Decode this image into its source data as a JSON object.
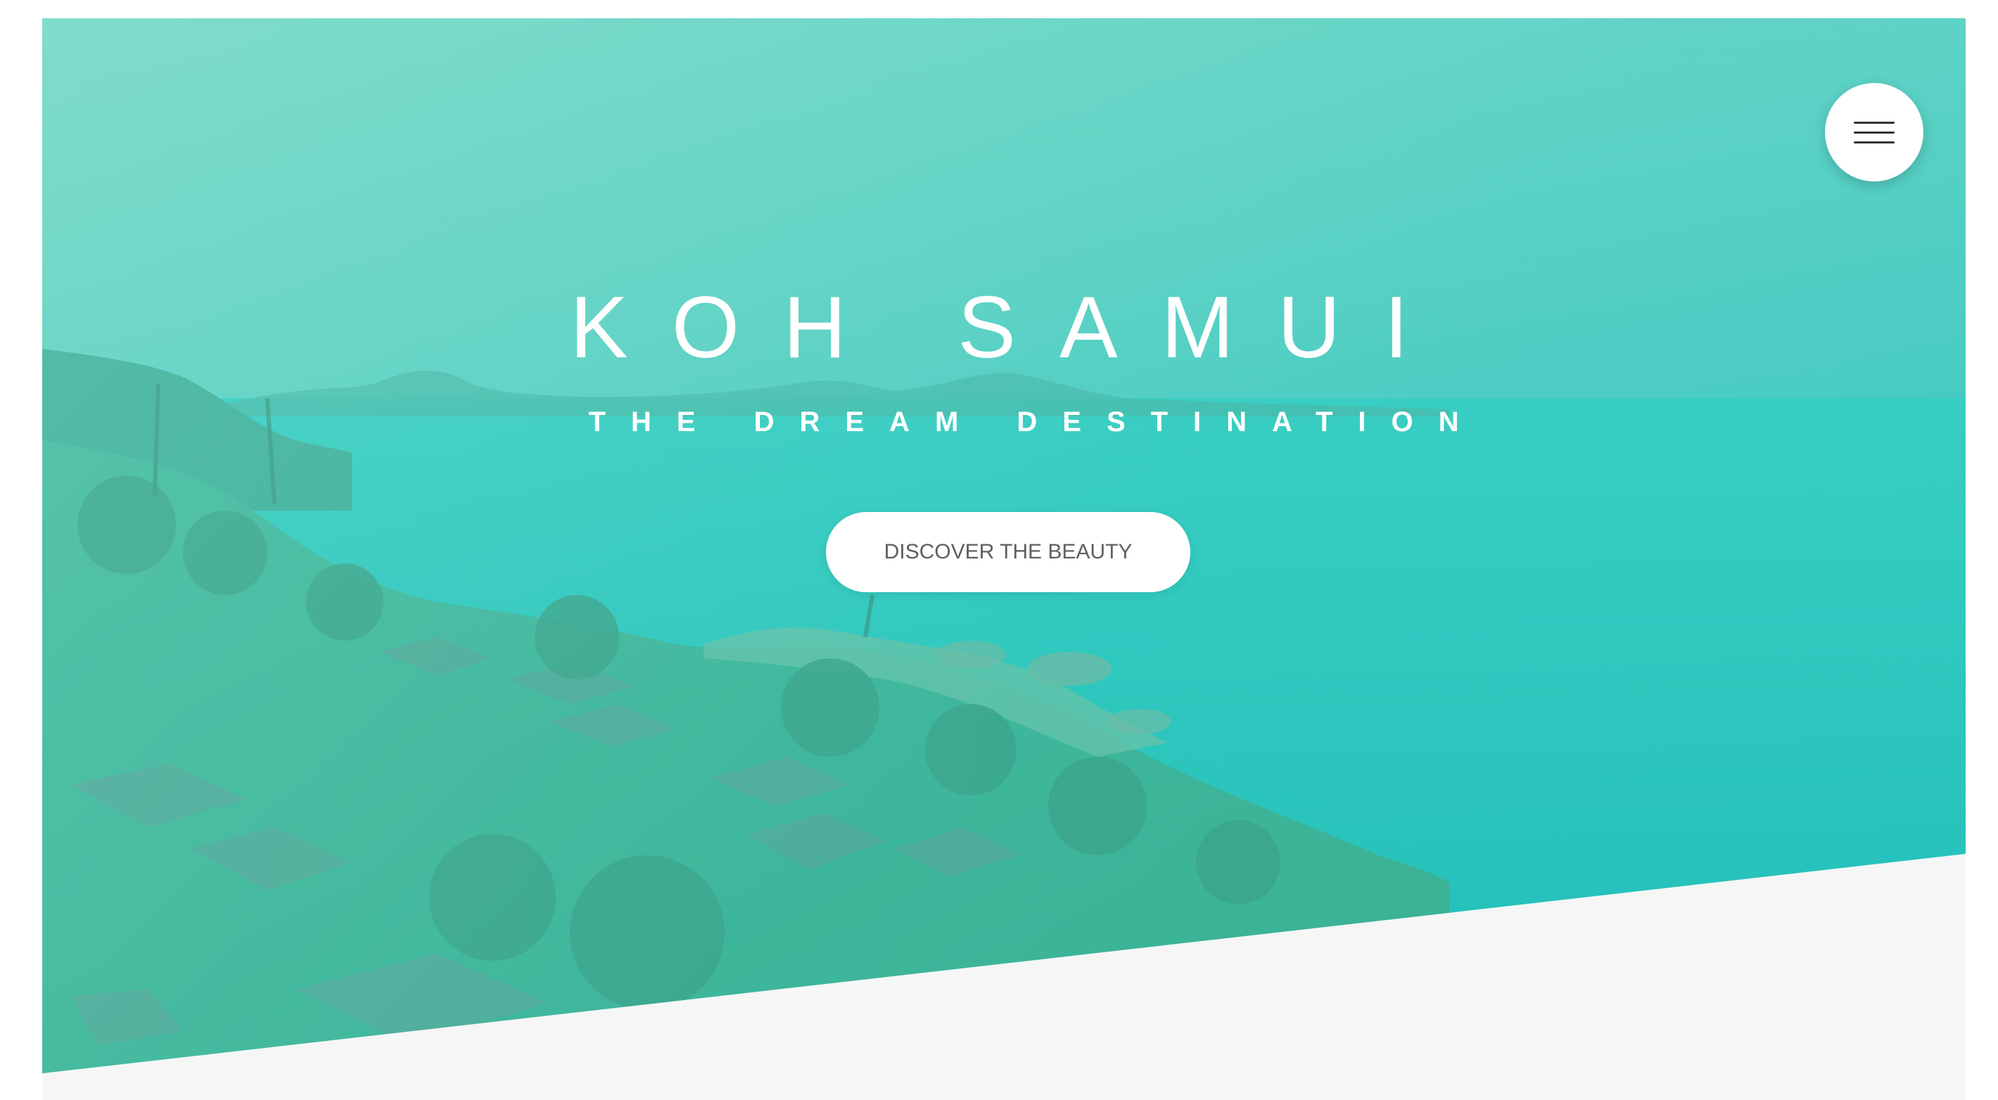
{
  "hero": {
    "title": "KOH SAMUI",
    "subtitle": "THE DREAM DESTINATION",
    "cta_label": "DISCOVER THE BEAUTY"
  },
  "nav": {
    "menu_icon": "hamburger-menu-icon"
  },
  "colors": {
    "overlay_teal": "#3fcfc0",
    "sea": "#27c3bb",
    "page_background": "#f6f6f6",
    "button_background": "#ffffff",
    "button_text": "#5f5f5f"
  }
}
